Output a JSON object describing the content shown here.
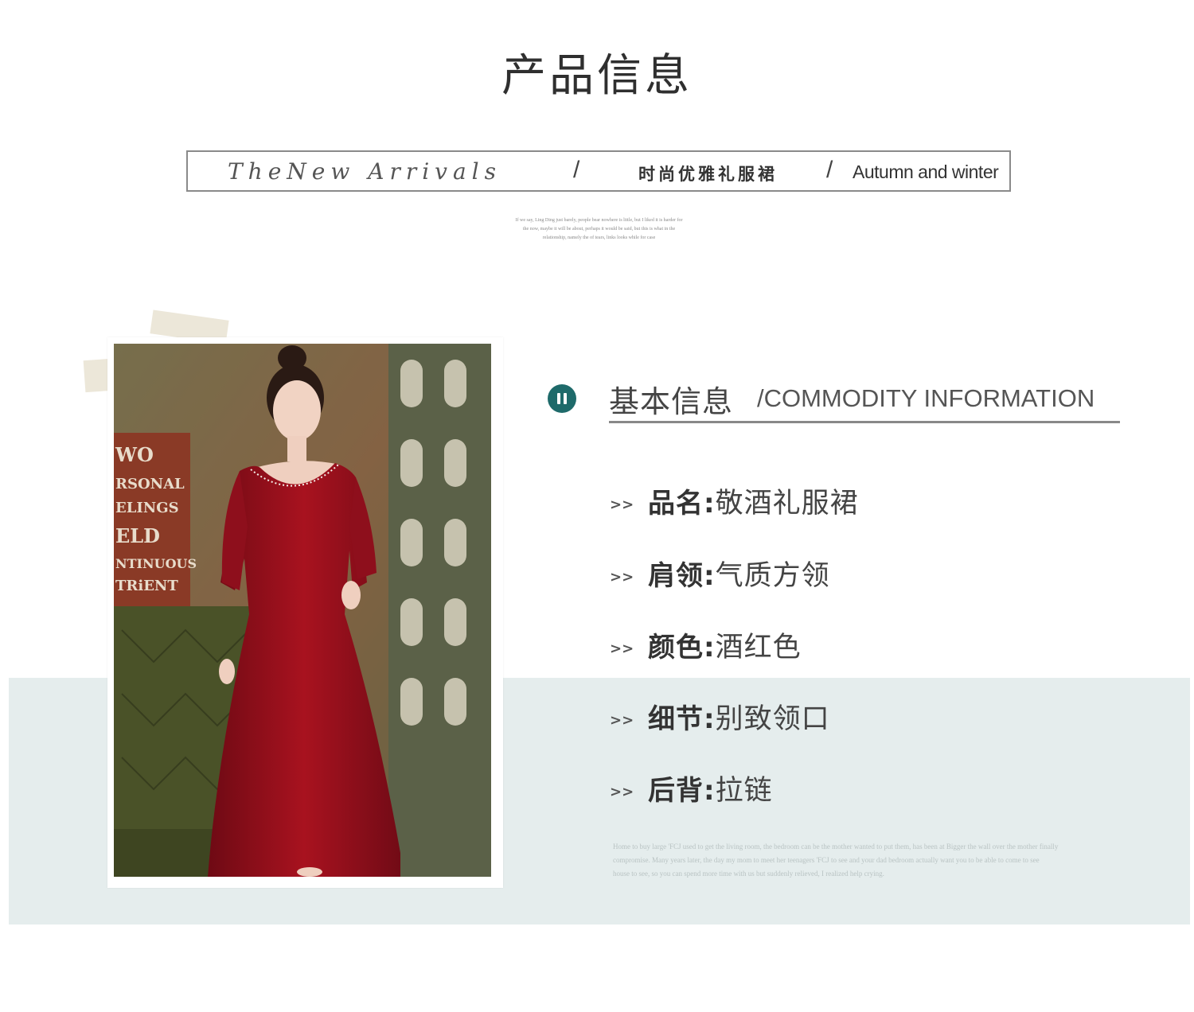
{
  "header": {
    "title": "产品信息"
  },
  "arrivals": {
    "script_text": "TheNew Arrivals",
    "slash": "/",
    "cn_text": "时尚优雅礼服裙",
    "en_text": "Autumn and winter"
  },
  "caption": {
    "lines": [
      "If we say, Ling Ding just barely, people bear nowhere is little, but I liked it is harder for",
      "the now, maybe it will be about, perhaps it would be said, but this is what in the",
      "relationship, namely the of tears, links looks while for case"
    ]
  },
  "photo": {
    "sign_lines": [
      "WO",
      "RSONAL",
      "ELINGS",
      "ELD",
      "NTINUOUS",
      "TRiENT"
    ]
  },
  "section": {
    "title_cn": "基本信息",
    "title_en": "/COMMODITY INFORMATION"
  },
  "info": {
    "arrows": ">>",
    "rows": [
      {
        "label": "品名:",
        "value": "敬酒礼服裙"
      },
      {
        "label": "肩领:",
        "value": "气质方领"
      },
      {
        "label": "颜色:",
        "value": "酒红色"
      },
      {
        "label": "细节:",
        "value": "别致领口"
      },
      {
        "label": "后背:",
        "value": "拉链"
      }
    ]
  },
  "footnote": {
    "lines": [
      "Home to buy large 'FCJ used to get the living room, the bedroom can be the mother wanted to put them, has been at Bigger the wall over the mother finally",
      "compromise. Many years later, the day my mom to meet her teenagers 'FCJ to see and your dad bedroom actually want you to be able to come to see",
      "house to see, so you can spend more time with us but suddenly relieved, I realized help crying."
    ]
  },
  "colors": {
    "accent_teal": "#1e6a6a",
    "band": "#e5eded",
    "dress_red": "#9c1020"
  }
}
